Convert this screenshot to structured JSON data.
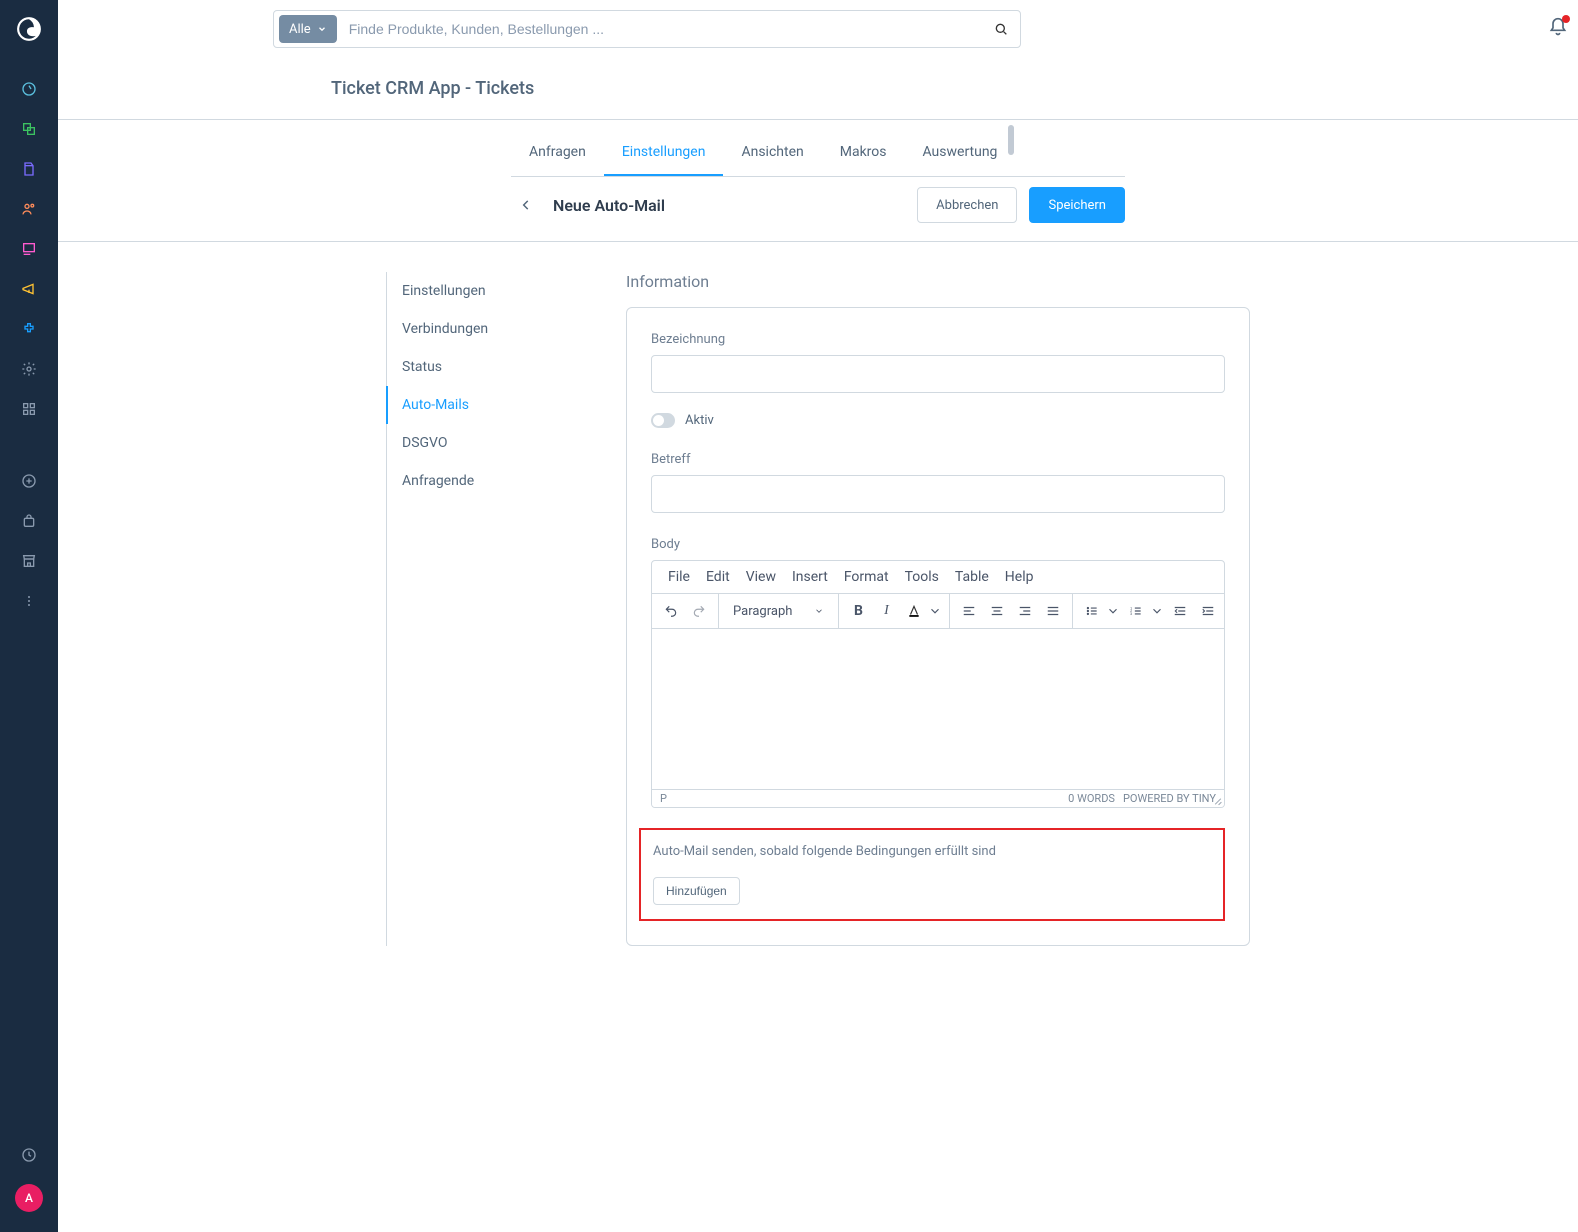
{
  "nav": {
    "avatarLetter": "A"
  },
  "search": {
    "filterLabel": "Alle",
    "placeholder": "Finde Produkte, Kunden, Bestellungen ..."
  },
  "page": {
    "title": "Ticket CRM App - Tickets"
  },
  "tabs": {
    "items": [
      "Anfragen",
      "Einstellungen",
      "Ansichten",
      "Makros",
      "Auswertung"
    ],
    "activeIndex": 1
  },
  "actionHeader": {
    "title": "Neue Auto-Mail",
    "cancel": "Abbrechen",
    "save": "Speichern"
  },
  "sideMenu": {
    "items": [
      "Einstellungen",
      "Verbindungen",
      "Status",
      "Auto-Mails",
      "DSGVO",
      "Anfragende"
    ],
    "activeIndex": 3
  },
  "form": {
    "sectionTitle": "Information",
    "labels": {
      "bezeichnung": "Bezeichnung",
      "aktiv": "Aktiv",
      "betreff": "Betreff",
      "body": "Body"
    },
    "values": {
      "bezeichnung": "",
      "betreff": ""
    }
  },
  "editor": {
    "menu": [
      "File",
      "Edit",
      "View",
      "Insert",
      "Format",
      "Tools",
      "Table",
      "Help"
    ],
    "paragraph": "Paragraph",
    "statusPath": "P",
    "words": "0 WORDS",
    "powered": "POWERED BY TINY"
  },
  "conditions": {
    "label": "Auto-Mail senden, sobald folgende Bedingungen erfüllt sind",
    "addBtn": "Hinzufügen"
  }
}
